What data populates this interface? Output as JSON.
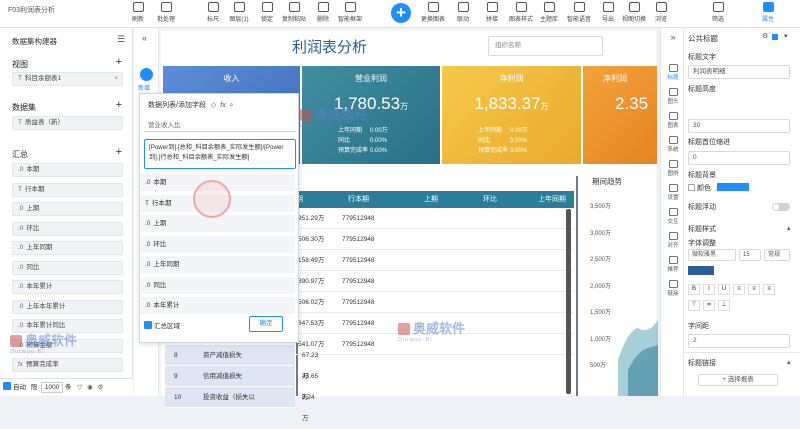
{
  "app": {
    "title": "F03利润表分析"
  },
  "toolbar": {
    "buttons": [
      {
        "name": "refresh-button",
        "label": "刷新"
      },
      {
        "name": "batch-process-button",
        "label": "批处理"
      },
      {
        "name": "ruler-button",
        "label": "标尺"
      },
      {
        "name": "layers-button",
        "label": "图层(1)"
      },
      {
        "name": "lock-button",
        "label": "锁定"
      },
      {
        "name": "copy-paste-button",
        "label": "复制粘贴"
      },
      {
        "name": "delete-button",
        "label": "删除"
      },
      {
        "name": "smart-frame-button",
        "label": "智能框架"
      },
      {
        "name": "change-chart-button",
        "label": "更换图表"
      },
      {
        "name": "link-button",
        "label": "联动"
      },
      {
        "name": "splice-button",
        "label": "拼接"
      },
      {
        "name": "chart-style-button",
        "label": "图表样式"
      },
      {
        "name": "theme-library-button",
        "label": "主题库"
      },
      {
        "name": "smart-voice-button",
        "label": "智能语音"
      },
      {
        "name": "export-button",
        "label": "导出"
      },
      {
        "name": "view-switch-button",
        "label": "视图切换"
      },
      {
        "name": "browse-button",
        "label": "浏览"
      },
      {
        "name": "filter-button",
        "label": "筛选"
      },
      {
        "name": "properties-button",
        "label": "属性"
      }
    ]
  },
  "left_panel": {
    "title": "数据集构建器",
    "view_title": "视图",
    "view_item": "科目余额表1",
    "dataset_title": "数据集",
    "dataset_item": "质益表（新）",
    "summary_title": "汇总",
    "summary_items": [
      {
        "k": ".0",
        "v": "本期"
      },
      {
        "k": "T",
        "v": "行本期"
      },
      {
        "k": ".0",
        "v": "上期"
      },
      {
        "k": ".0",
        "v": "环比"
      },
      {
        "k": ".0",
        "v": "上年同期"
      },
      {
        "k": ".0",
        "v": "同比"
      },
      {
        "k": ".0",
        "v": "本年累计"
      },
      {
        "k": ".0",
        "v": "上年本年累计"
      },
      {
        "k": ".0",
        "v": "本年累计同比"
      },
      {
        "k": ".0",
        "v": "预算金额"
      },
      {
        "k": "fx",
        "v": "预算完成率"
      }
    ],
    "bottom": {
      "auto": "自动",
      "limit_label": "限",
      "limit_value": "1000",
      "limit_unit": "条"
    }
  },
  "side_strip": {
    "label": "新增"
  },
  "report": {
    "title": "利润表分析",
    "org_placeholder": "组织名称",
    "cards": [
      {
        "title": "收入",
        "value": "",
        "unit": "",
        "rows": []
      },
      {
        "title": "营业利润",
        "value": "1,780.53",
        "unit": "万",
        "rows": [
          [
            "上年同期",
            "0.00万"
          ],
          [
            "同比",
            "0.00%"
          ],
          [
            "预算完成率",
            "0.00%"
          ]
        ]
      },
      {
        "title": "净利润",
        "value": "1,833.37",
        "unit": "万",
        "rows": [
          [
            "上年同期",
            "0.00万"
          ],
          [
            "同比",
            "0.00%"
          ],
          [
            "预算完成率",
            "0.00%"
          ]
        ]
      },
      {
        "title": "净利润",
        "value": "2.35",
        "unit": "",
        "rows": []
      }
    ],
    "table": {
      "headers": [
        "期",
        "行本期",
        "上期",
        "环比",
        "上年同期"
      ],
      "rows": [
        [
          "951.29万",
          "779512948"
        ],
        [
          "506.30万",
          "779512948"
        ],
        [
          "158.49万",
          "779512948"
        ],
        [
          "890.97万",
          "779512948"
        ],
        [
          "506.02万",
          "779512948"
        ],
        [
          "847.53万",
          "779512948"
        ],
        [
          "541.07万",
          "779512948"
        ]
      ],
      "left_rows": [
        {
          "no": "8",
          "name": "资产减值损失",
          "val": "67.23万"
        },
        {
          "no": "9",
          "name": "信用减值损失",
          "val": "43.65万"
        },
        {
          "no": "10",
          "name": "投资收益（损失以",
          "val": "8.24万"
        }
      ]
    },
    "chart": {
      "title": "期间趋势"
    }
  },
  "chart_data": {
    "type": "area",
    "title": "期间趋势",
    "yticks": [
      "3,500万",
      "3,000万",
      "2,500万",
      "2,000万",
      "1,500万",
      "1,000万",
      "500万"
    ],
    "series": []
  },
  "popup": {
    "title": "数据列表/添加字段",
    "search": "营业收入比",
    "formula": "[Power到].[总和_科目余额表_实际发生额]/[Power到].[行总和_科目余额表_实际发生额]",
    "items": [
      {
        "k": ".0",
        "v": "本期"
      },
      {
        "k": "T",
        "v": "行本期"
      },
      {
        "k": ".0",
        "v": "上期"
      },
      {
        "k": ".0",
        "v": "环比"
      },
      {
        "k": ".0",
        "v": "上年同期"
      },
      {
        "k": ".0",
        "v": "同比"
      },
      {
        "k": ".0",
        "v": "本年累计"
      }
    ],
    "footer": "汇总区域",
    "ok": "确定"
  },
  "right_strip": {
    "items": [
      "标题",
      "图头",
      "图表",
      "系统",
      "图例",
      "设置",
      "交互",
      "对齐",
      "推荐",
      "链接"
    ]
  },
  "right_panel": {
    "section": "公共标题",
    "title_text_label": "标题文字",
    "title_text_value": "利润表明细",
    "title_height_label": "标题高度",
    "title_height_value": "30",
    "title_offset_label": "标题首位缩进",
    "title_offset_value": "0",
    "title_bg_label": "标题背景",
    "color_label": "颜色",
    "title_float_label": "标题浮动",
    "title_style_label": "标题样式",
    "font_adjust_label": "字体调整",
    "font_family": "微软雅黑",
    "font_size": "15",
    "font_weight": "常规",
    "spacing_label": "字间距",
    "spacing_value": "2",
    "link_label": "标题链接",
    "select_report": "+ 选择报表",
    "accent": "#1f8fff"
  },
  "watermark": {
    "text": "奥威软件",
    "sub": "Durway-BI"
  }
}
